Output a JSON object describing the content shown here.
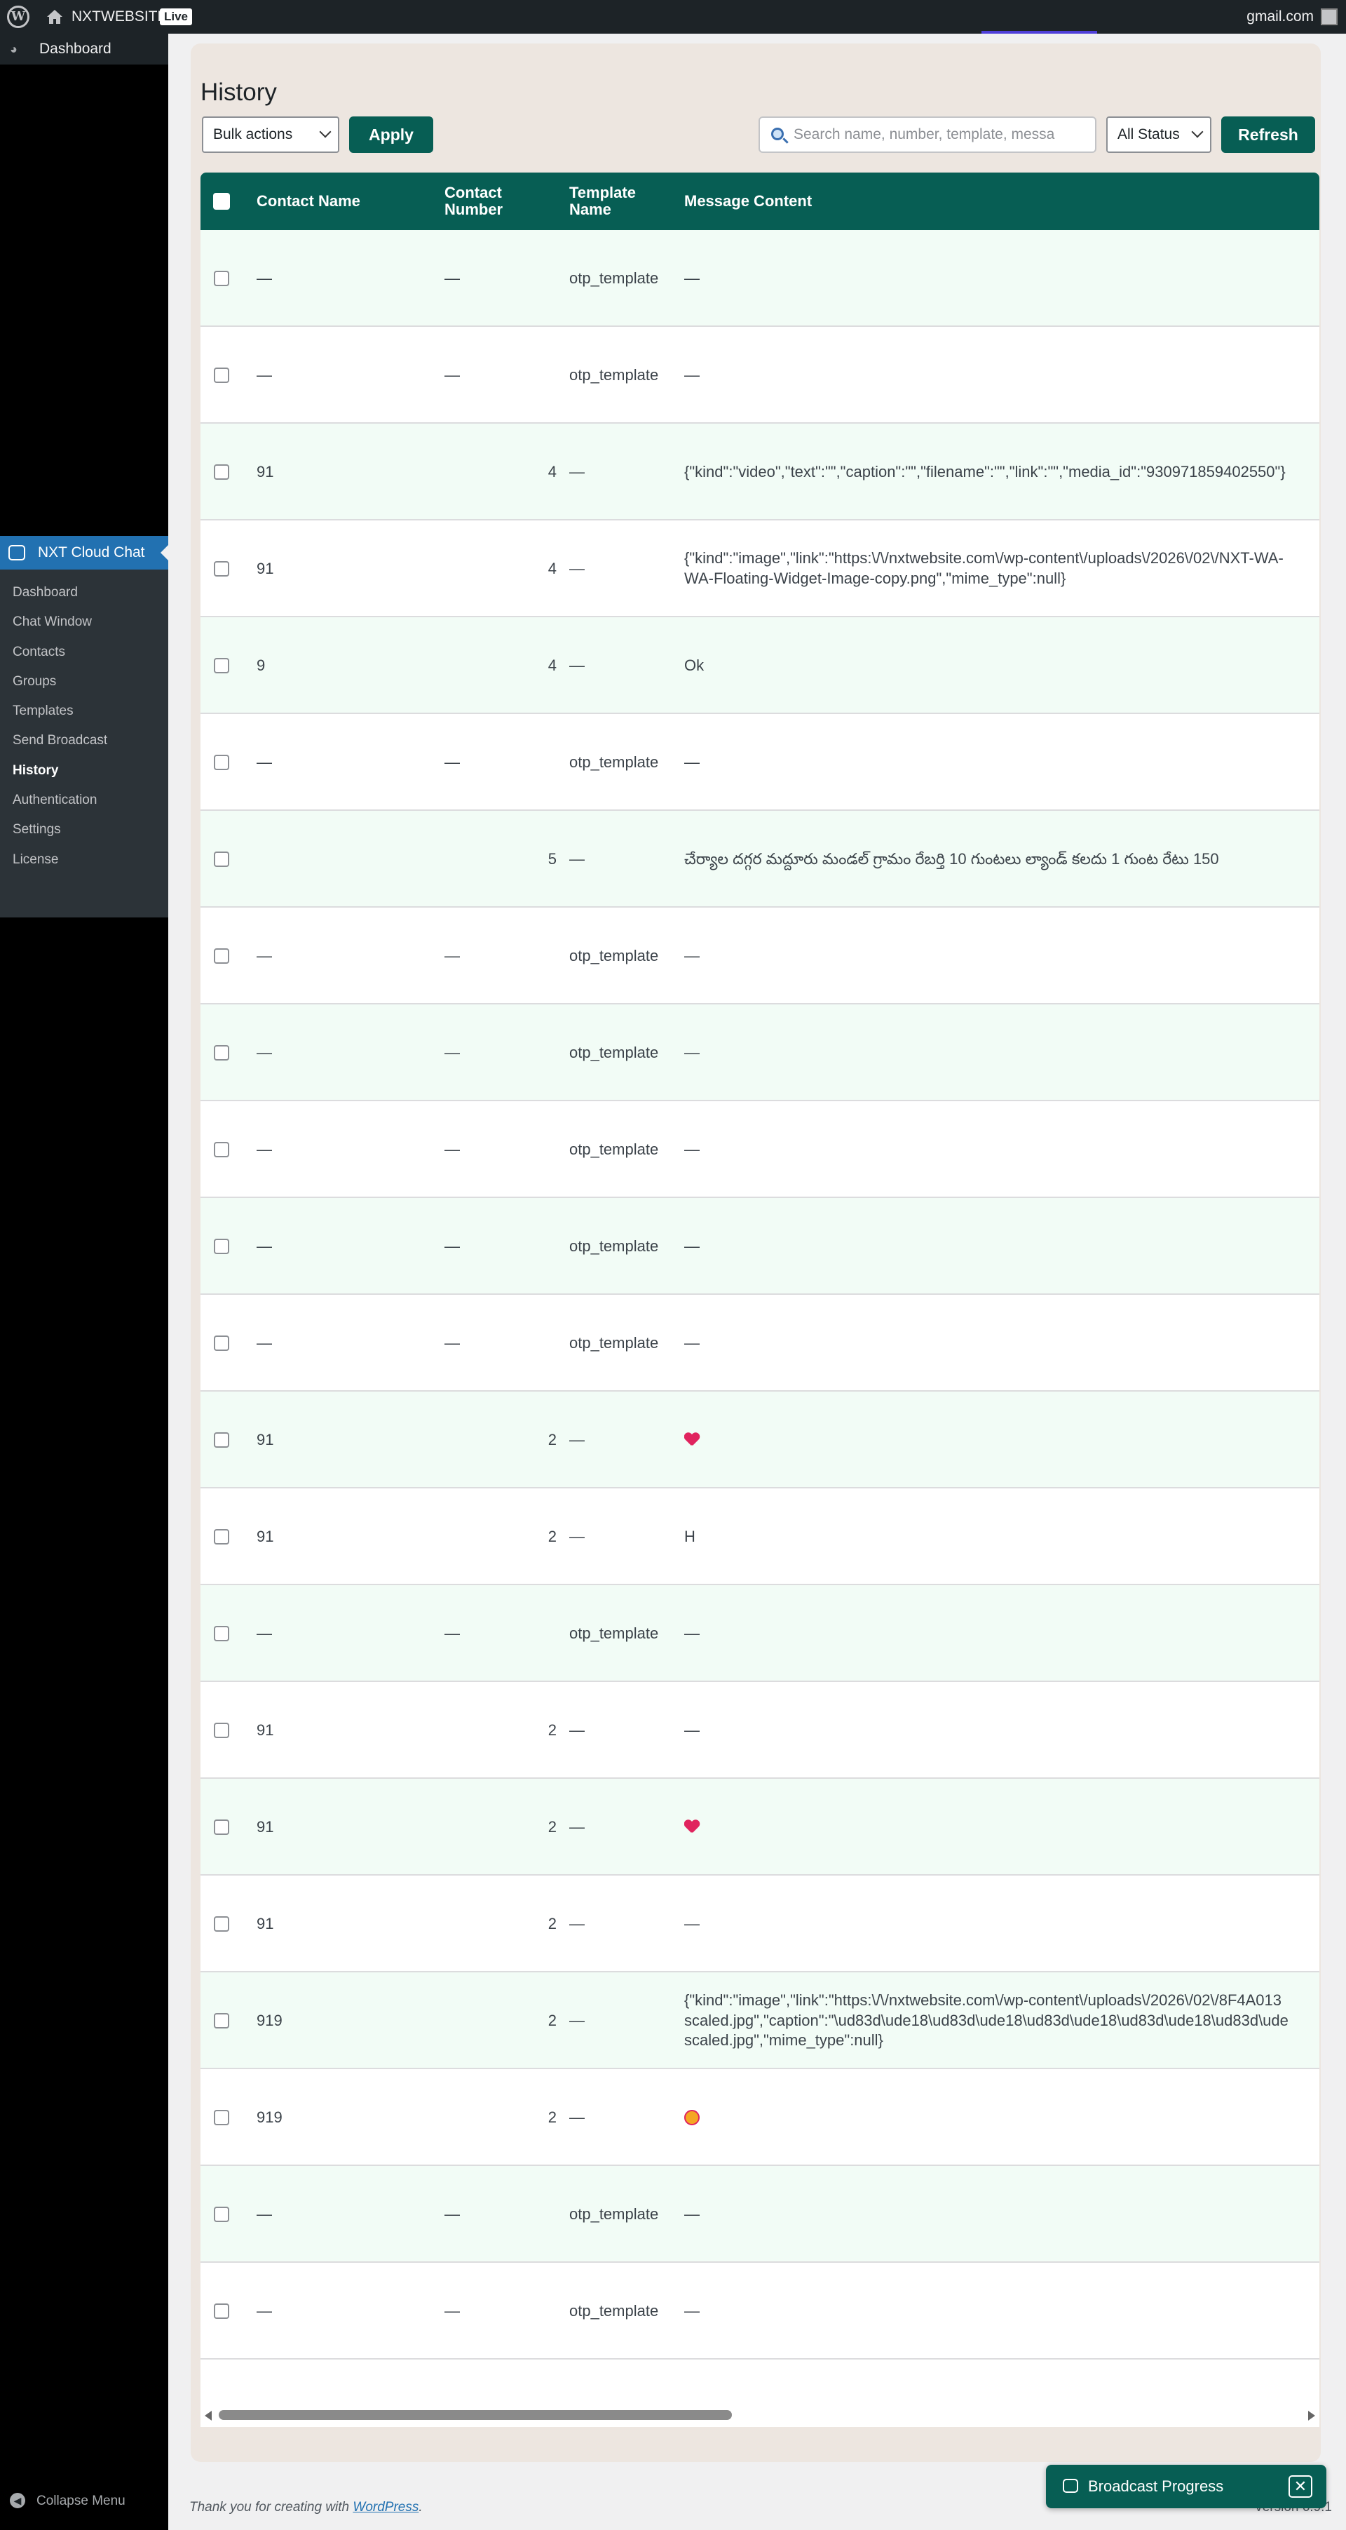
{
  "adminbar": {
    "site_name": "NXTWEBSITE",
    "live_badge": "Live",
    "account": "gmail.com"
  },
  "sidebar": {
    "dashboard_label": "Dashboard",
    "plugin_label": "NXT Cloud Chat",
    "items": [
      {
        "label": "Dashboard"
      },
      {
        "label": "Chat Window"
      },
      {
        "label": "Contacts"
      },
      {
        "label": "Groups"
      },
      {
        "label": "Templates"
      },
      {
        "label": "Send Broadcast"
      },
      {
        "label": "History"
      },
      {
        "label": "Authentication"
      },
      {
        "label": "Settings"
      },
      {
        "label": "License"
      }
    ],
    "active_item": "History",
    "collapse_label": "Collapse Menu"
  },
  "page": {
    "title": "History",
    "bulk_actions": "Bulk actions",
    "apply_label": "Apply",
    "search_placeholder": "Search name, number, template, messa",
    "status_filter": "All Status",
    "refresh_label": "Refresh"
  },
  "table": {
    "columns": [
      "Contact Name",
      "Contact Number",
      "Template Name",
      "Message Content"
    ],
    "rows": [
      {
        "name": "—",
        "number": "—",
        "template": "otp_template",
        "message": "—"
      },
      {
        "name": "—",
        "number": "—",
        "template": "otp_template",
        "message": "—"
      },
      {
        "name": "91",
        "number": "4",
        "template": "—",
        "message": "{\"kind\":\"video\",\"text\":\"\",\"caption\":\"\",\"filename\":\"\",\"link\":\"\",\"media_id\":\"930971859402550\"}"
      },
      {
        "name": "91",
        "number": "4",
        "template": "—",
        "message": "{\"kind\":\"image\",\"link\":\"https:\\/\\/nxtwebsite.com\\/wp-content\\/uploads\\/2026\\/02\\/NXT-WA-\nWA-Floating-Widget-Image-copy.png\",\"mime_type\":null}"
      },
      {
        "name": "9",
        "number": "4",
        "template": "—",
        "message": "Ok"
      },
      {
        "name": "—",
        "number": "—",
        "template": "otp_template",
        "message": "—"
      },
      {
        "name": "",
        "number": "5",
        "template": "—",
        "message": "చేర్యాల దగ్గర మద్దూరు మండల్ గ్రామం రేబర్తి 10 గుంటలు ల్యాండ్ కలదు 1 గుంట రేటు 150"
      },
      {
        "name": "—",
        "number": "—",
        "template": "otp_template",
        "message": "—"
      },
      {
        "name": "—",
        "number": "—",
        "template": "otp_template",
        "message": "—"
      },
      {
        "name": "—",
        "number": "—",
        "template": "otp_template",
        "message": "—"
      },
      {
        "name": "—",
        "number": "—",
        "template": "otp_template",
        "message": "—"
      },
      {
        "name": "—",
        "number": "—",
        "template": "otp_template",
        "message": "—"
      },
      {
        "name": "91",
        "number": "2",
        "template": "—",
        "message": "",
        "icon": "heart-icon"
      },
      {
        "name": "91",
        "number": "2",
        "template": "—",
        "message": "H"
      },
      {
        "name": "—",
        "number": "—",
        "template": "otp_template",
        "message": "—"
      },
      {
        "name": "91",
        "number": "2",
        "template": "—",
        "message": "—"
      },
      {
        "name": "91",
        "number": "2",
        "template": "—",
        "message": "",
        "icon": "heart-icon"
      },
      {
        "name": "91",
        "number": "2",
        "template": "—",
        "message": "—"
      },
      {
        "name": "919",
        "number": "2",
        "template": "—",
        "message": "{\"kind\":\"image\",\"link\":\"https:\\/\\/nxtwebsite.com\\/wp-content\\/uploads\\/2026\\/02\\/8F4A013\nscaled.jpg\",\"caption\":\"\\ud83d\\ude18\\ud83d\\ude18\\ud83d\\ude18\\ud83d\\ude18\\ud83d\\ude\nscaled.jpg\",\"mime_type\":null}"
      },
      {
        "name": "919",
        "number": "2",
        "template": "—",
        "message": "",
        "icon": "face-emoji-icon"
      },
      {
        "name": "—",
        "number": "—",
        "template": "otp_template",
        "message": "—"
      },
      {
        "name": "—",
        "number": "—",
        "template": "otp_template",
        "message": "—"
      }
    ]
  },
  "footer": {
    "thanks_prefix": "Thank you for creating with ",
    "wordpress_link": "WordPress",
    "thanks_suffix": ".",
    "version": "Version 6.9.1"
  },
  "broadcast": {
    "label": "Broadcast Progress",
    "close": "✕"
  },
  "colors": {
    "brand": "#075e54",
    "row_alt": "#f2fcf6",
    "menu_active": "#2271b1"
  }
}
